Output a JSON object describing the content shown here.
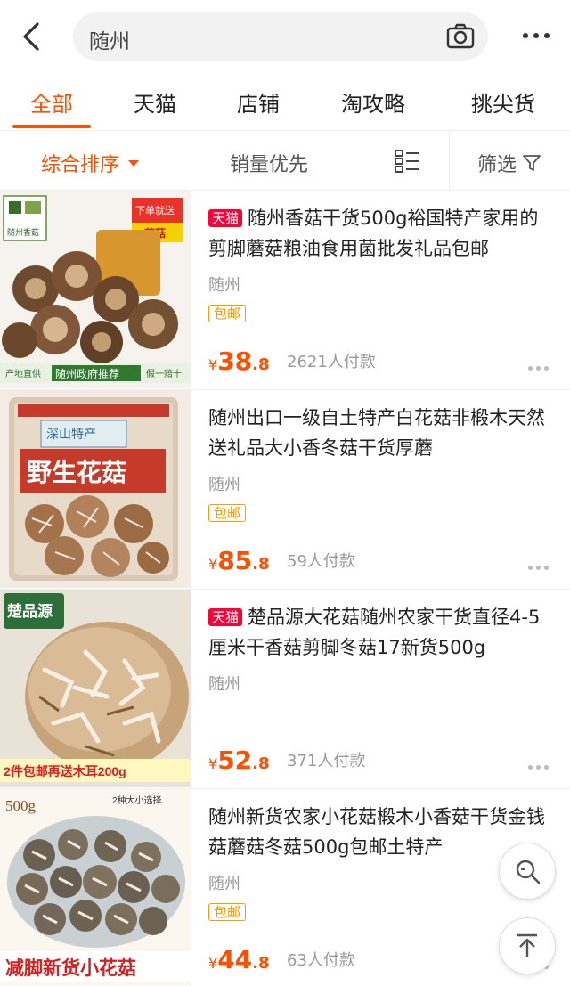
{
  "search": {
    "query": "随州"
  },
  "tabs": [
    {
      "label": "全部",
      "active": true
    },
    {
      "label": "天猫",
      "active": false
    },
    {
      "label": "店铺",
      "active": false
    },
    {
      "label": "淘攻略",
      "active": false
    },
    {
      "label": "挑尖货",
      "active": false
    }
  ],
  "sort": {
    "comprehensive": "综合排序",
    "sales_first": "销量优先",
    "filter": "筛选"
  },
  "colors": {
    "accent": "#ff5000",
    "tmall_badge": "#ff0036",
    "free_ship": "#ff9900"
  },
  "products": [
    {
      "tmall": "天猫",
      "title": "随州香菇干货500g裕国特产家用的剪脚蘑菇粮油食用菌批发礼品包邮",
      "location": "随州",
      "badge": "包邮",
      "currency": "¥",
      "price_int": "38",
      "price_dec": ".8",
      "sales": "2621人付款",
      "image_text": {
        "top_left": "随州香菇",
        "top_right_1": "下单就送",
        "top_right_2": "花菇",
        "bottom_1": "产地直供",
        "bottom_2": "随州政府推荐",
        "bottom_3": "假一赔十"
      }
    },
    {
      "tmall": "",
      "title": "随州出口一级自土特产白花菇非椴木天然送礼品大小香冬菇干货厚蘑",
      "location": "随州",
      "badge": "包邮",
      "currency": "¥",
      "price_int": "85",
      "price_dec": ".8",
      "sales": "59人付款",
      "image_text": {
        "label_1": "深山特产",
        "label_2": "野生花菇"
      }
    },
    {
      "tmall": "天猫",
      "title": "楚品源大花菇随州农家干货直径4-5厘米干香菇剪脚冬菇17新货500g",
      "location": "随州",
      "badge": "",
      "currency": "¥",
      "price_int": "52",
      "price_dec": ".8",
      "sales": "371人付款",
      "image_text": {
        "brand": "楚品源",
        "promo": "2件包邮再送木耳200g"
      }
    },
    {
      "tmall": "",
      "title": "随州新货农家小花菇椴木小香菇干货金钱菇蘑菇冬菇500g包邮土特产",
      "location": "随州",
      "badge": "包邮",
      "currency": "¥",
      "price_int": "44",
      "price_dec": ".8",
      "sales": "63人付款",
      "image_text": {
        "weight": "500g",
        "option": "2种大小选择",
        "banner": "减脚新货小花菇"
      }
    }
  ],
  "icons": {
    "back": "back-arrow-icon",
    "camera": "camera-icon",
    "more": "more-dots-icon",
    "view": "list-view-icon",
    "filter": "filter-funnel-icon",
    "find_similar": "find-similar-icon",
    "back_to_top": "back-to-top-icon"
  }
}
